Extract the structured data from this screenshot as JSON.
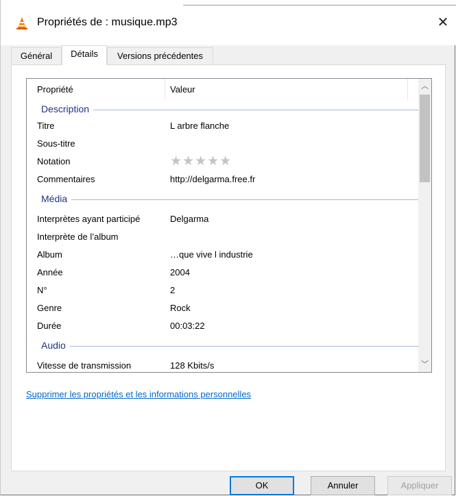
{
  "window": {
    "title": "Propriétés de : musique.mp3",
    "close_glyph": "✕"
  },
  "tabs": [
    {
      "label": "Général",
      "active": false
    },
    {
      "label": "Détails",
      "active": true
    },
    {
      "label": "Versions précédentes",
      "active": false
    }
  ],
  "list": {
    "headers": {
      "property": "Propriété",
      "value": "Valeur"
    },
    "groups": {
      "description": "Description",
      "media": "Média",
      "audio": "Audio"
    },
    "rows": [
      {
        "key": "Titre",
        "value": "L arbre flanche"
      },
      {
        "key": "Sous-titre",
        "value": ""
      },
      {
        "key": "Notation",
        "value": "",
        "rating": 0,
        "rating_max": 5
      },
      {
        "key": "Commentaires",
        "value": "http://delgarma.free.fr"
      },
      {
        "key": "Interprètes ayant participé",
        "value": "Delgarma"
      },
      {
        "key": "Interprète de l’album",
        "value": ""
      },
      {
        "key": "Album",
        "value": "…que vive l industrie"
      },
      {
        "key": "Année",
        "value": "2004"
      },
      {
        "key": "N°",
        "value": "2"
      },
      {
        "key": "Genre",
        "value": "Rock"
      },
      {
        "key": "Durée",
        "value": "00:03:22"
      },
      {
        "key": "Vitesse de transmission",
        "value": "128 Kbits/s"
      }
    ],
    "stars": "★★★★★",
    "scroll": {
      "up": "︿",
      "down": "﹀"
    }
  },
  "link_text": "Supprimer les propriétés et les informations personnelles",
  "buttons": {
    "ok": "OK",
    "cancel": "Annuler",
    "apply": "Appliquer"
  },
  "colors": {
    "accent": "#0078d7",
    "group_title": "#1e3287",
    "link": "#0066cc"
  }
}
